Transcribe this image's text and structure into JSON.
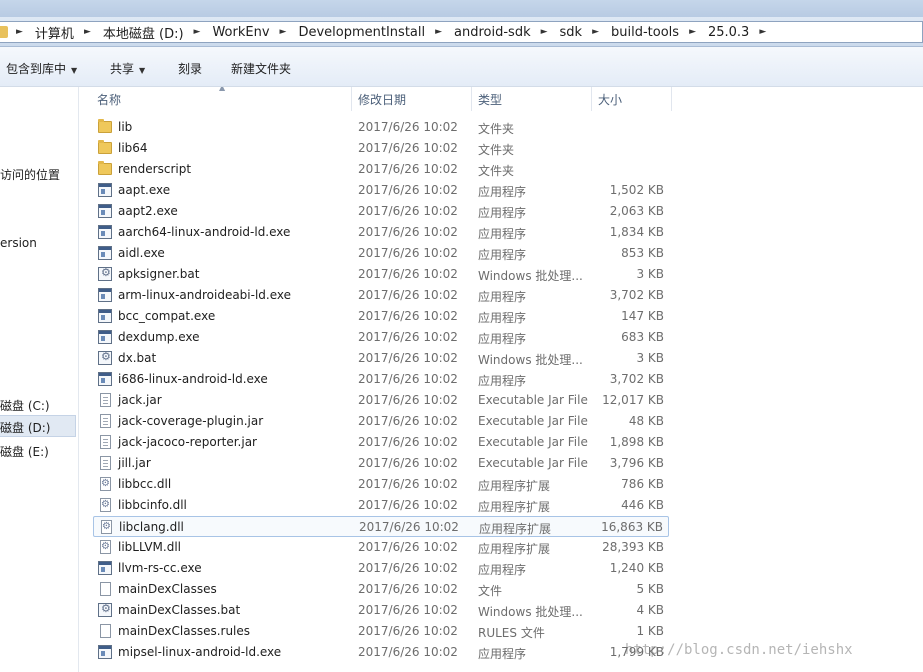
{
  "address": {
    "crumbs": [
      "计算机",
      "本地磁盘 (D:)",
      "WorkEnv",
      "DevelopmentInstall",
      "android-sdk",
      "sdk",
      "build-tools",
      "25.0.3"
    ]
  },
  "toolbar": {
    "include_label": "包含到库中",
    "share_label": "共享",
    "burn_label": "刻录",
    "new_folder_label": "新建文件夹"
  },
  "nav": {
    "recent_places": "访问的位置",
    "version": "ersion",
    "drive_c": "磁盘 (C:)",
    "drive_d": "磁盘 (D:)",
    "drive_e": "磁盘 (E:)"
  },
  "columns": {
    "name": "名称",
    "date": "修改日期",
    "type": "类型",
    "size": "大小"
  },
  "files": [
    {
      "name": "lib",
      "date": "2017/6/26 10:02",
      "type": "文件夹",
      "size": "",
      "icon": "folder-icon"
    },
    {
      "name": "lib64",
      "date": "2017/6/26 10:02",
      "type": "文件夹",
      "size": "",
      "icon": "folder-icon"
    },
    {
      "name": "renderscript",
      "date": "2017/6/26 10:02",
      "type": "文件夹",
      "size": "",
      "icon": "folder-icon"
    },
    {
      "name": "aapt.exe",
      "date": "2017/6/26 10:02",
      "type": "应用程序",
      "size": "1,502 KB",
      "icon": "exe-icon"
    },
    {
      "name": "aapt2.exe",
      "date": "2017/6/26 10:02",
      "type": "应用程序",
      "size": "2,063 KB",
      "icon": "exe-icon"
    },
    {
      "name": "aarch64-linux-android-ld.exe",
      "date": "2017/6/26 10:02",
      "type": "应用程序",
      "size": "1,834 KB",
      "icon": "exe-icon"
    },
    {
      "name": "aidl.exe",
      "date": "2017/6/26 10:02",
      "type": "应用程序",
      "size": "853 KB",
      "icon": "exe-icon"
    },
    {
      "name": "apksigner.bat",
      "date": "2017/6/26 10:02",
      "type": "Windows 批处理...",
      "size": "3 KB",
      "icon": "batch-file-icon"
    },
    {
      "name": "arm-linux-androideabi-ld.exe",
      "date": "2017/6/26 10:02",
      "type": "应用程序",
      "size": "3,702 KB",
      "icon": "exe-icon"
    },
    {
      "name": "bcc_compat.exe",
      "date": "2017/6/26 10:02",
      "type": "应用程序",
      "size": "147 KB",
      "icon": "exe-icon"
    },
    {
      "name": "dexdump.exe",
      "date": "2017/6/26 10:02",
      "type": "应用程序",
      "size": "683 KB",
      "icon": "exe-icon"
    },
    {
      "name": "dx.bat",
      "date": "2017/6/26 10:02",
      "type": "Windows 批处理...",
      "size": "3 KB",
      "icon": "batch-file-icon"
    },
    {
      "name": "i686-linux-android-ld.exe",
      "date": "2017/6/26 10:02",
      "type": "应用程序",
      "size": "3,702 KB",
      "icon": "exe-icon"
    },
    {
      "name": "jack.jar",
      "date": "2017/6/26 10:02",
      "type": "Executable Jar File",
      "size": "12,017 KB",
      "icon": "jar-icon"
    },
    {
      "name": "jack-coverage-plugin.jar",
      "date": "2017/6/26 10:02",
      "type": "Executable Jar File",
      "size": "48 KB",
      "icon": "jar-icon"
    },
    {
      "name": "jack-jacoco-reporter.jar",
      "date": "2017/6/26 10:02",
      "type": "Executable Jar File",
      "size": "1,898 KB",
      "icon": "jar-icon"
    },
    {
      "name": "jill.jar",
      "date": "2017/6/26 10:02",
      "type": "Executable Jar File",
      "size": "3,796 KB",
      "icon": "jar-icon"
    },
    {
      "name": "libbcc.dll",
      "date": "2017/6/26 10:02",
      "type": "应用程序扩展",
      "size": "786 KB",
      "icon": "dll-icon"
    },
    {
      "name": "libbcinfo.dll",
      "date": "2017/6/26 10:02",
      "type": "应用程序扩展",
      "size": "446 KB",
      "icon": "dll-icon"
    },
    {
      "name": "libclang.dll",
      "date": "2017/6/26 10:02",
      "type": "应用程序扩展",
      "size": "16,863 KB",
      "icon": "dll-icon"
    },
    {
      "name": "libLLVM.dll",
      "date": "2017/6/26 10:02",
      "type": "应用程序扩展",
      "size": "28,393 KB",
      "icon": "dll-icon"
    },
    {
      "name": "llvm-rs-cc.exe",
      "date": "2017/6/26 10:02",
      "type": "应用程序",
      "size": "1,240 KB",
      "icon": "exe-icon"
    },
    {
      "name": "mainDexClasses",
      "date": "2017/6/26 10:02",
      "type": "文件",
      "size": "5 KB",
      "icon": "file-icon"
    },
    {
      "name": "mainDexClasses.bat",
      "date": "2017/6/26 10:02",
      "type": "Windows 批处理...",
      "size": "4 KB",
      "icon": "batch-file-icon"
    },
    {
      "name": "mainDexClasses.rules",
      "date": "2017/6/26 10:02",
      "type": "RULES 文件",
      "size": "1 KB",
      "icon": "file-icon"
    },
    {
      "name": "mipsel-linux-android-ld.exe",
      "date": "2017/6/26 10:02",
      "type": "应用程序",
      "size": "1,799 KB",
      "icon": "exe-icon"
    }
  ],
  "watermark": "http://blog.csdn.net/iehshx"
}
